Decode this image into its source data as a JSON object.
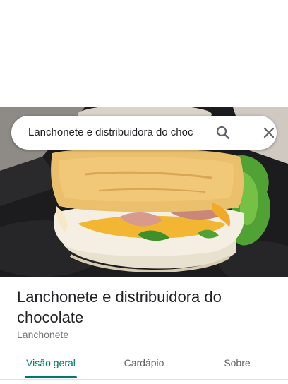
{
  "search": {
    "query": "Lanchonete e distribuidora do choc",
    "search_icon": "search-icon",
    "close_icon": "close-icon"
  },
  "place": {
    "name": "Lanchonete e distribuidora do chocolate",
    "category": "Lanchonete"
  },
  "tabs": [
    {
      "label": "Visão geral",
      "active": true
    },
    {
      "label": "Cardápio",
      "active": false
    },
    {
      "label": "Sobre",
      "active": false
    }
  ],
  "colors": {
    "accent": "#00796b",
    "text_primary": "#202124",
    "text_secondary": "#70757a"
  }
}
